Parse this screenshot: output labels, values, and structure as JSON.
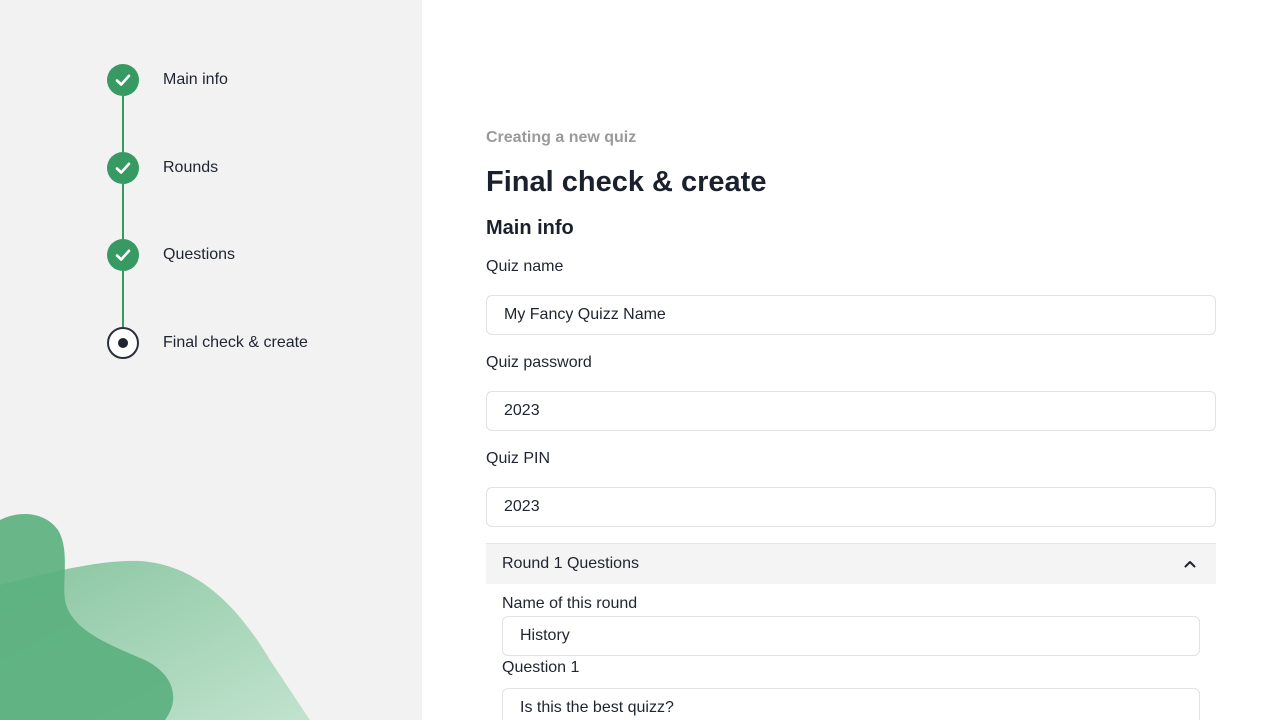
{
  "steps": [
    {
      "label": "Main info",
      "status": "done"
    },
    {
      "label": "Rounds",
      "status": "done"
    },
    {
      "label": "Questions",
      "status": "done"
    },
    {
      "label": "Final check & create",
      "status": "current"
    }
  ],
  "header": {
    "subtitle": "Creating a new quiz",
    "title": "Final check & create"
  },
  "main_info": {
    "section_title": "Main info",
    "quiz_name": {
      "label": "Quiz name",
      "value": "My Fancy Quizz Name"
    },
    "quiz_password": {
      "label": "Quiz password",
      "value": "2023"
    },
    "quiz_pin": {
      "label": "Quiz PIN",
      "value": "2023"
    }
  },
  "round1": {
    "title": "Round 1 Questions",
    "expanded": true,
    "round_name": {
      "label": "Name of this round",
      "value": "History"
    },
    "question1": {
      "label": "Question 1",
      "value": "Is this the best quizz?"
    }
  },
  "colors": {
    "accent_green": "#369a62",
    "sidebar_bg": "#f2f2f2",
    "accordion_bg": "#f4f4f4"
  }
}
